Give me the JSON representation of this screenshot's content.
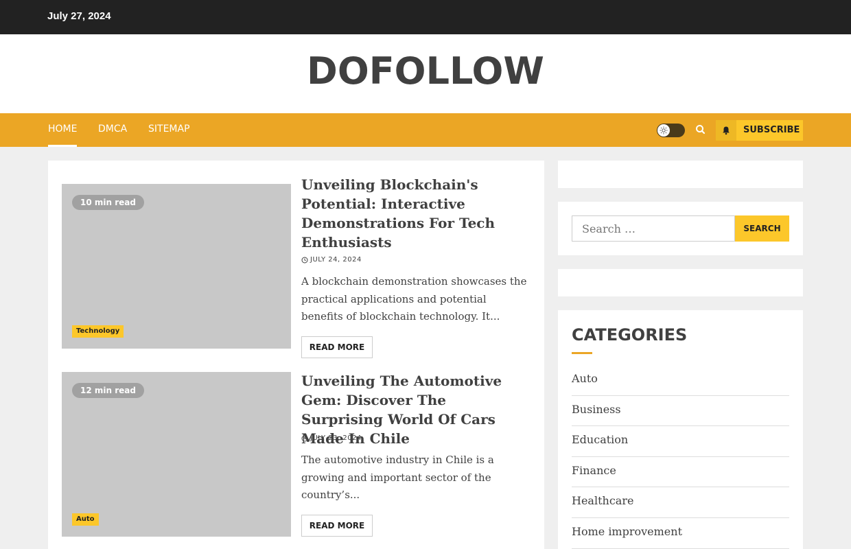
{
  "topbar": {
    "date": "July 27, 2024"
  },
  "site": {
    "logo": "DOFOLLOW"
  },
  "nav": {
    "items": [
      {
        "label": "Home"
      },
      {
        "label": "DMCA"
      },
      {
        "label": "Sitemap"
      }
    ],
    "subscribe_label": "Subscribe"
  },
  "posts": [
    {
      "read_time": "10 min read",
      "category": "Technology",
      "title": "Unveiling Blockchain's Potential: Interactive Demonstrations For Tech Enthusiasts",
      "date": "July 24, 2024",
      "excerpt": "A blockchain demonstration showcases the practical applications and potential benefits of blockchain technology. It...",
      "read_more": "Read More"
    },
    {
      "read_time": "12 min read",
      "category": "Auto",
      "title": "Unveiling The Automotive Gem: Discover The Surprising World Of Cars Made In Chile",
      "date": "July 23, 2024",
      "excerpt": "The automotive industry in Chile is a growing and important sector of the country’s...",
      "read_more": "Read More"
    }
  ],
  "sidebar": {
    "search": {
      "placeholder": "Search …",
      "button": "Search"
    },
    "categories": {
      "title": "Categories",
      "items": [
        "Auto",
        "Business",
        "Education",
        "Finance",
        "Healthcare",
        "Home improvement"
      ]
    }
  },
  "colors": {
    "accent": "#eba625",
    "yellow": "#fcc72a",
    "dark": "#222222",
    "text": "#404040"
  }
}
